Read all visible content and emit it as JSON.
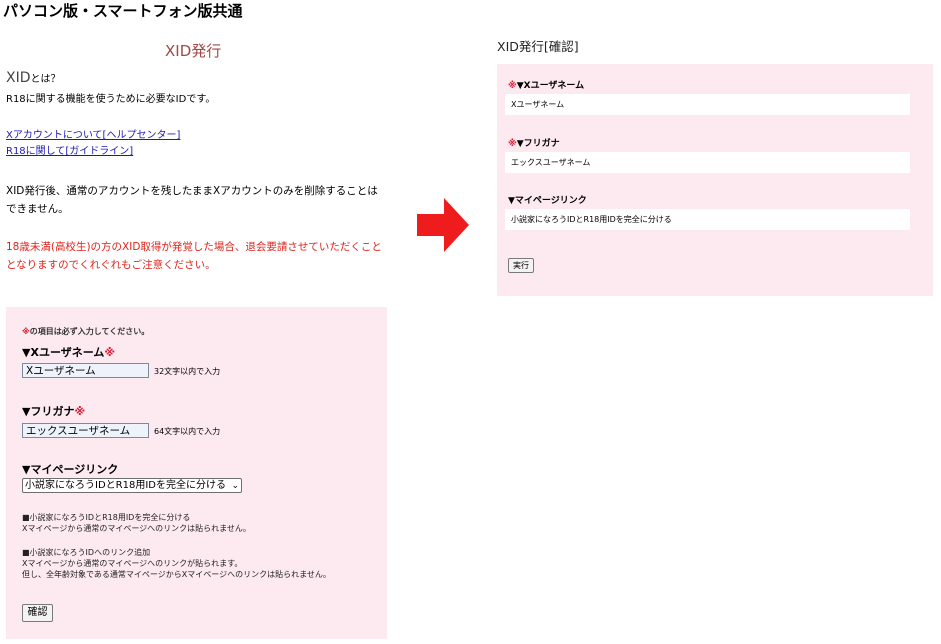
{
  "page_heading": "パソコン版・スマートフォン版共通",
  "left": {
    "title": "XID発行",
    "what_is_x": "XID",
    "what_is_rest": "とは？",
    "intro_desc": "R18に関する機能を使うために必要なIDです。",
    "links": [
      "Xアカウントについて[ヘルプセンター]",
      "R18に関して[ガイドライン]"
    ],
    "note_delete": "XID発行後、通常のアカウントを残したままXアカウントのみを削除することはできません。",
    "note_minor": "18歳未満(高校生)の方のXID取得が発覚した場合、退会要請させていただくこととなりますのでくれぐれもご注意ください。",
    "form": {
      "required_mark": "※",
      "required_note": "の項目は必ず入力してください。",
      "username_label": "▼Xユーザネーム",
      "username_value": "Xユーザネーム",
      "username_hint": "32文字以内で入力",
      "furigana_label": "▼フリガナ",
      "furigana_value": "エックスユーザネーム",
      "furigana_hint": "64文字以内で入力",
      "mypage_label": "▼マイページリンク",
      "mypage_selected": "小説家になろうIDとR18用IDを完全に分ける",
      "help1_title": "■小説家になろうIDとR18用IDを完全に分ける",
      "help1_line1": "Xマイページから通常のマイページへのリンクは貼られません。",
      "help2_title": "■小説家になろうIDへのリンク追加",
      "help2_line1": "Xマイページから通常のマイページへのリンクが貼られます。",
      "help2_line2": "但し、全年齢対象である通常マイページからXマイページへのリンクは貼られません。",
      "confirm_button": "確認"
    }
  },
  "right": {
    "title": "XID発行[確認]",
    "required_mark": "※",
    "username_label": "▼Xユーザネーム",
    "username_value": "Xユーザネーム",
    "furigana_label": "▼フリガナ",
    "furigana_value": "エックスユーザネーム",
    "mypage_label": "▼マイページリンク",
    "mypage_value": "小説家になろうIDとR18用IDを完全に分ける",
    "execute_button": "実行"
  },
  "colors": {
    "panel_bg": "#fdeaf0",
    "arrow": "#ee1c1c",
    "title_accent": "#a04848",
    "warning": "#e0241b",
    "required": "#d8182f"
  },
  "icons": {
    "arrow": "right-arrow-icon",
    "select_chevron": "chevron-down-icon"
  }
}
